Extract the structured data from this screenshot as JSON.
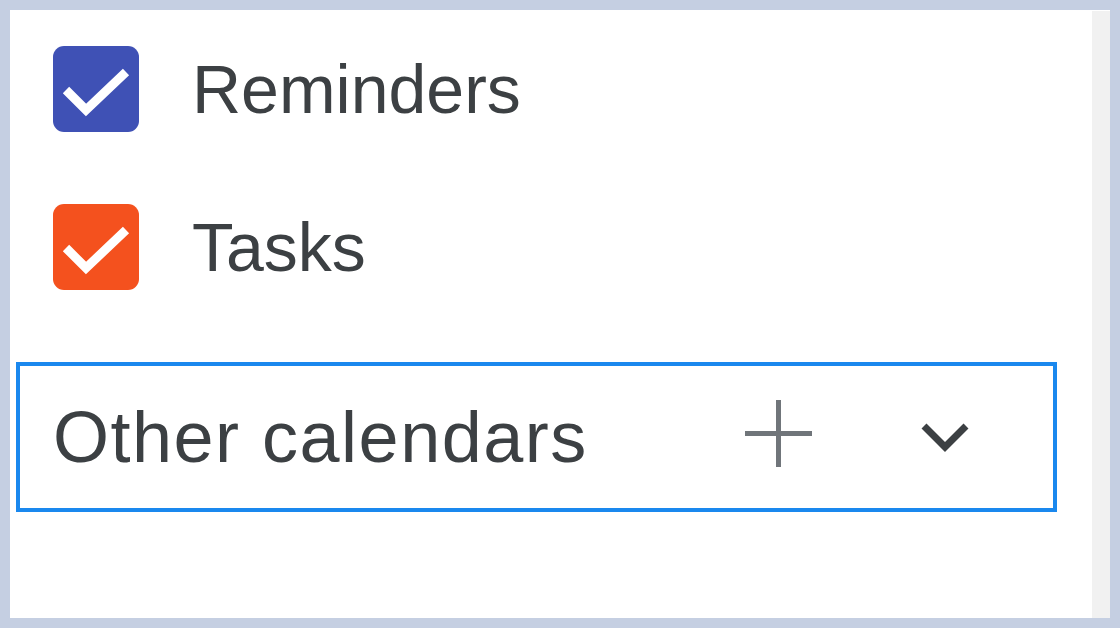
{
  "calendars": [
    {
      "label": "Reminders",
      "checked": true,
      "color": "#3f51b5"
    },
    {
      "label": "Tasks",
      "checked": true,
      "color": "#f4511e"
    }
  ],
  "other_calendars": {
    "title": "Other calendars",
    "expanded": false,
    "highlighted": true
  }
}
